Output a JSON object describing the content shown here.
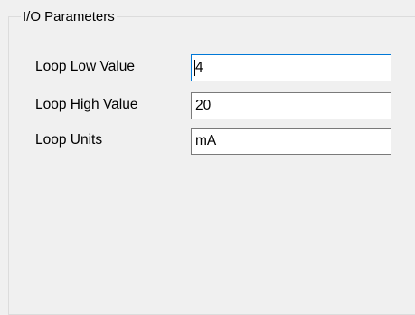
{
  "group": {
    "title": "I/O Parameters"
  },
  "fields": [
    {
      "label": "Loop Low Value",
      "value": "4",
      "focused": true
    },
    {
      "label": "Loop High Value",
      "value": "20",
      "focused": false
    },
    {
      "label": "Loop Units",
      "value": "mA",
      "focused": false
    }
  ],
  "colors": {
    "background": "#f0f0f0",
    "focus_border": "#0078d7",
    "field_border": "#7a7a7a",
    "group_border": "#dcdcdc"
  }
}
